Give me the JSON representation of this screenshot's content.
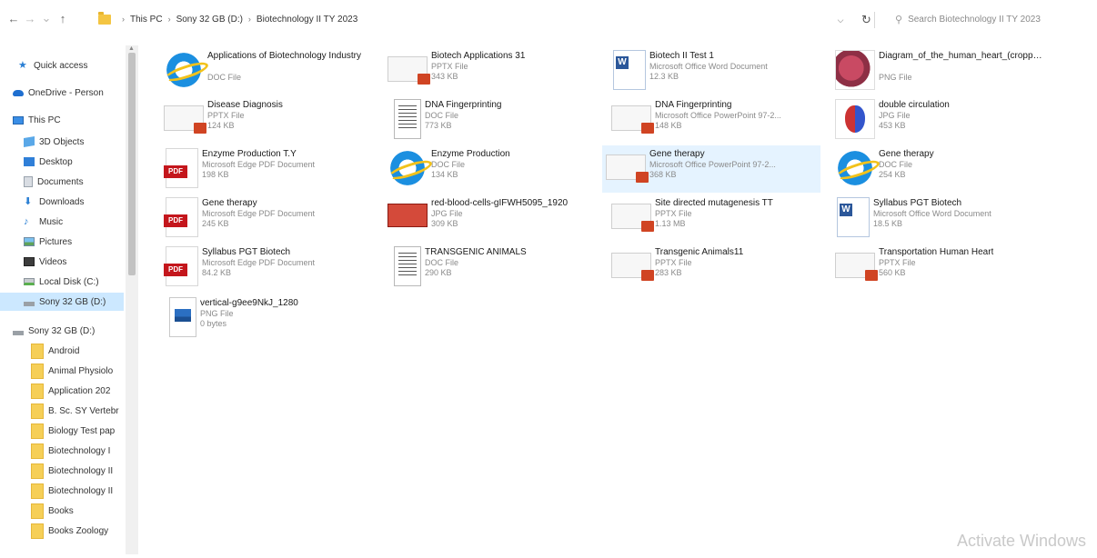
{
  "address": {
    "breadcrumbs": [
      "This PC",
      "Sony 32 GB (D:)",
      "Biotechnology II TY 2023"
    ],
    "search_placeholder": "Search Biotechnology II TY 2023"
  },
  "sidebar": {
    "items": [
      {
        "label": "Quick access",
        "icon": "star-icon"
      },
      {
        "label": "OneDrive - Person",
        "icon": "cloud-icon"
      },
      {
        "label": "This PC",
        "icon": "computer-icon"
      },
      {
        "label": "3D Objects",
        "icon": "cube-icon"
      },
      {
        "label": "Desktop",
        "icon": "desktop-icon"
      },
      {
        "label": "Documents",
        "icon": "documents-icon"
      },
      {
        "label": "Downloads",
        "icon": "download-icon"
      },
      {
        "label": "Music",
        "icon": "music-icon"
      },
      {
        "label": "Pictures",
        "icon": "pictures-icon"
      },
      {
        "label": "Videos",
        "icon": "videos-icon"
      },
      {
        "label": "Local Disk (C:)",
        "icon": "disk-icon"
      },
      {
        "label": "Sony 32 GB (D:)",
        "icon": "usb-drive-icon"
      },
      {
        "label": "Sony 32 GB (D:)",
        "icon": "usb-drive-icon"
      },
      {
        "label": "Android",
        "icon": "folder-icon"
      },
      {
        "label": "Animal Physiolo",
        "icon": "folder-icon"
      },
      {
        "label": "Application 202",
        "icon": "folder-icon"
      },
      {
        "label": "B. Sc. SY Vertebr",
        "icon": "folder-icon"
      },
      {
        "label": "Biology Test pap",
        "icon": "folder-icon"
      },
      {
        "label": "Biotechnology I",
        "icon": "folder-icon"
      },
      {
        "label": "Biotechnology II",
        "icon": "folder-icon"
      },
      {
        "label": "Biotechnology II",
        "icon": "folder-icon"
      },
      {
        "label": "Books",
        "icon": "folder-icon"
      },
      {
        "label": "Books Zoology",
        "icon": "folder-icon"
      }
    ]
  },
  "files": [
    {
      "name": "Applications of Biotechnology Industry",
      "type": "DOC File",
      "size": "",
      "icon": "ie-icon"
    },
    {
      "name": "Biotech Applications 31",
      "type": "PPTX File",
      "size": "343 KB",
      "icon": "powerpoint-icon"
    },
    {
      "name": "Biotech II Test 1",
      "type": "Microsoft Office Word Document",
      "size": "12.3 KB",
      "icon": "word-icon"
    },
    {
      "name": "Diagram_of_the_human_heart_(cropped).svg",
      "type": "PNG File",
      "size": "",
      "icon": "heart-image-icon"
    },
    {
      "name": "Disease Diagnosis",
      "type": "PPTX File",
      "size": "124 KB",
      "icon": "powerpoint-icon"
    },
    {
      "name": "DNA Fingerprinting",
      "type": "DOC File",
      "size": "773 KB",
      "icon": "doc-icon"
    },
    {
      "name": "DNA Fingerprinting",
      "type": "Microsoft Office PowerPoint 97-2...",
      "size": "148 KB",
      "icon": "powerpoint-icon"
    },
    {
      "name": "double circulation",
      "type": "JPG File",
      "size": "453 KB",
      "icon": "circulation-image-icon"
    },
    {
      "name": "Enzyme Production T.Y",
      "type": "Microsoft Edge PDF Document",
      "size": "198 KB",
      "icon": "pdf-icon"
    },
    {
      "name": "Enzyme Production",
      "type": "DOC File",
      "size": "134 KB",
      "icon": "ie-icon"
    },
    {
      "name": "Gene therapy",
      "type": "Microsoft Office PowerPoint 97-2...",
      "size": "368 KB",
      "icon": "powerpoint-icon"
    },
    {
      "name": "Gene therapy",
      "type": "DOC File",
      "size": "254 KB",
      "icon": "ie-icon"
    },
    {
      "name": "Gene therapy",
      "type": "Microsoft Edge PDF Document",
      "size": "245 KB",
      "icon": "pdf-icon"
    },
    {
      "name": "red-blood-cells-gIFWH5095_1920",
      "type": "JPG File",
      "size": "309 KB",
      "icon": "jpg-icon"
    },
    {
      "name": "Site directed mutagenesis TT",
      "type": "PPTX File",
      "size": "1.13 MB",
      "icon": "powerpoint-icon"
    },
    {
      "name": "Syllabus PGT Biotech",
      "type": "Microsoft Office Word Document",
      "size": "18.5 KB",
      "icon": "word-icon"
    },
    {
      "name": "Syllabus PGT Biotech",
      "type": "Microsoft Edge PDF Document",
      "size": "84.2 KB",
      "icon": "pdf-icon"
    },
    {
      "name": "TRANSGENIC ANIMALS",
      "type": "DOC File",
      "size": "290 KB",
      "icon": "doc-icon"
    },
    {
      "name": "Transgenic Animals11",
      "type": "PPTX File",
      "size": "283 KB",
      "icon": "powerpoint-icon"
    },
    {
      "name": "Transportation Human Heart",
      "type": "PPTX File",
      "size": "560 KB",
      "icon": "powerpoint-icon"
    },
    {
      "name": "vertical-g9ee9NkJ_1280",
      "type": "PNG File",
      "size": "0 bytes",
      "icon": "png-icon"
    }
  ],
  "watermark": "Activate Windows"
}
